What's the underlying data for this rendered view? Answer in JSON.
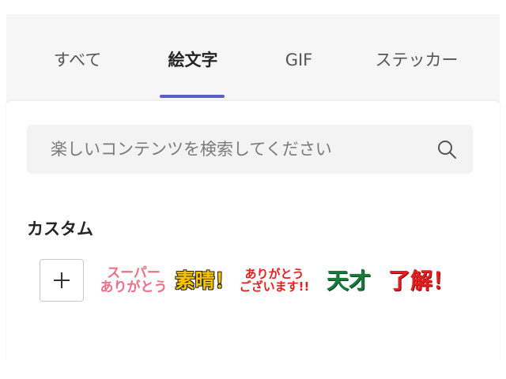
{
  "tabs": [
    {
      "label": "すべて",
      "active": false
    },
    {
      "label": "絵文字",
      "active": true
    },
    {
      "label": "GIF",
      "active": false
    },
    {
      "label": "ステッカー",
      "active": false
    }
  ],
  "search": {
    "placeholder": "楽しいコンテンツを検索してください",
    "value": "",
    "icon": "search-icon"
  },
  "section": {
    "title": "カスタム"
  },
  "add_button": {
    "icon": "plus-icon"
  },
  "stickers": [
    {
      "lines": [
        "スーパー",
        "ありがとう"
      ]
    },
    {
      "lines": [
        "素晴！"
      ]
    },
    {
      "lines": [
        "ありがとう",
        "ございます!!"
      ]
    },
    {
      "lines": [
        "天才"
      ]
    },
    {
      "lines": [
        "了解！"
      ]
    }
  ],
  "colors": {
    "accent": "#5b5fc7",
    "tab_bar_bg": "#f6f6f6",
    "search_bg": "#f3f3f3"
  }
}
